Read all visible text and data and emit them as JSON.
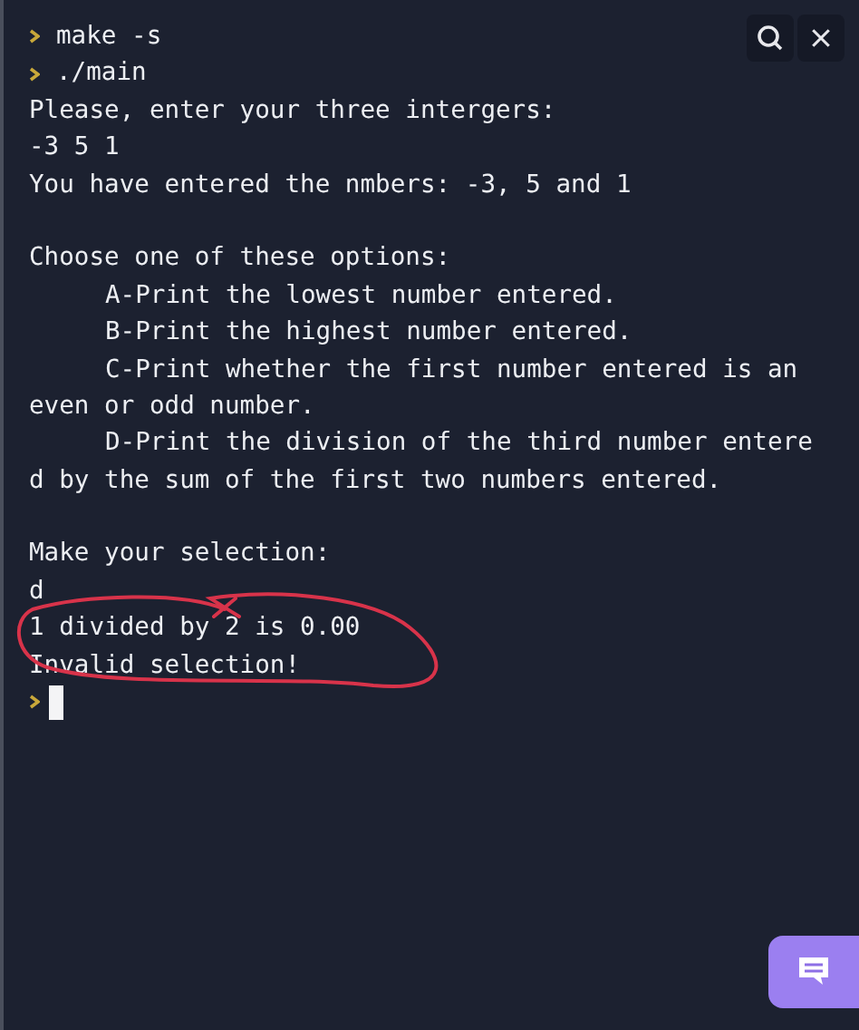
{
  "terminal": {
    "lines": [
      {
        "kind": "prompt",
        "text": "make -s"
      },
      {
        "kind": "prompt",
        "text": "./main"
      },
      {
        "kind": "output",
        "text": "Please, enter your three intergers:"
      },
      {
        "kind": "output",
        "text": "-3 5 1"
      },
      {
        "kind": "output",
        "text": "You have entered the nmbers: -3, 5 and 1"
      },
      {
        "kind": "blank"
      },
      {
        "kind": "output",
        "text": "Choose one of these options:"
      },
      {
        "kind": "indented",
        "text": "A-Print the lowest number entered."
      },
      {
        "kind": "indented",
        "text": "B-Print the highest number entered."
      },
      {
        "kind": "indented",
        "text": "C-Print whether the first number entered is an"
      },
      {
        "kind": "output",
        "text": "even or odd number."
      },
      {
        "kind": "indented",
        "text": "D-Print the division of the third number entere"
      },
      {
        "kind": "output",
        "text": "d by the sum of the first two numbers entered."
      },
      {
        "kind": "blank"
      },
      {
        "kind": "output",
        "text": "Make your selection:"
      },
      {
        "kind": "output",
        "text": "d"
      },
      {
        "kind": "output",
        "text": "1 divided by 2 is 0.00"
      },
      {
        "kind": "output",
        "text": "Invalid selection!"
      },
      {
        "kind": "cursor"
      }
    ]
  }
}
